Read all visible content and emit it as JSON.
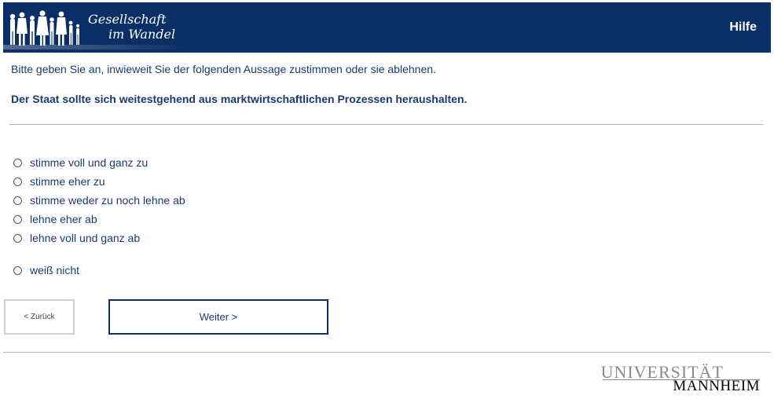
{
  "header": {
    "logo_line1": "Gesellschaft",
    "logo_line2": "im Wandel",
    "help_label": "Hilfe"
  },
  "survey": {
    "instruction": "Bitte geben Sie an, inwieweit Sie der folgenden Aussage zustimmen oder sie ablehnen.",
    "statement": "Der Staat sollte sich weitestgehend aus marktwirtschaftlichen Prozessen heraushalten.",
    "options": [
      "stimme voll und ganz zu",
      "stimme eher zu",
      "stimme weder zu noch lehne ab",
      "lehne eher ab",
      "lehne voll und ganz ab"
    ],
    "dont_know": "weiß nicht"
  },
  "nav": {
    "back_label": "< Zurück",
    "next_label": "Weiter >"
  },
  "footer": {
    "uni_top": "UNIVERSITÄT",
    "uni_bottom": "MANNHEIM"
  },
  "colors": {
    "header_bg": "#0a2f66",
    "text": "#1a3a6e"
  }
}
